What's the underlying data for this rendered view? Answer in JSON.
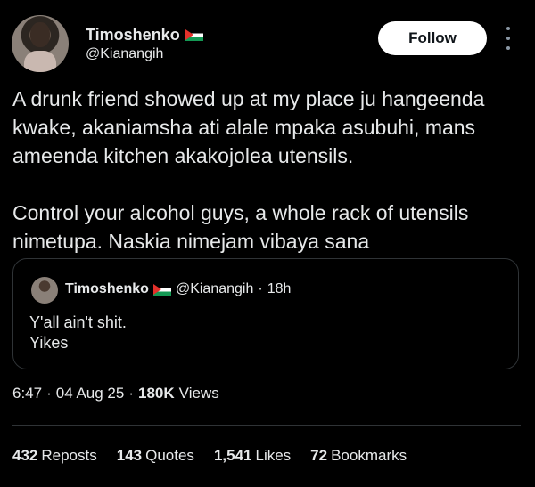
{
  "author": {
    "display_name": "Timoshenko",
    "handle": "@Kianangih",
    "flag_icon": "palestine-flag-icon"
  },
  "follow_label": "Follow",
  "tweet": {
    "text": "A drunk friend showed up at my place ju hangeenda kwake, akaniamsha ati alale mpaka asubuhi, mans ameenda kitchen akakojolea utensils.\n\nControl your alcohol guys, a whole rack of utensils nimetupa. Naskia nimejam vibaya sana"
  },
  "quoted": {
    "display_name": "Timoshenko",
    "handle": "@Kianangih",
    "separator": "·",
    "time": "18h",
    "line1": "Y'all ain't shit.",
    "line2": "Yikes"
  },
  "meta": {
    "time": "6:47",
    "separator": "·",
    "date": "04 Aug 25",
    "views_count": "180K",
    "views_label": "Views"
  },
  "stats": {
    "reposts_count": "432",
    "reposts_label": "Reposts",
    "quotes_count": "143",
    "quotes_label": "Quotes",
    "likes_count": "1,541",
    "likes_label": "Likes",
    "bookmarks_count": "72",
    "bookmarks_label": "Bookmarks"
  },
  "colors": {
    "background": "#000000",
    "text": "#e7e9ea",
    "border": "#2f3336",
    "button_bg": "#ffffff"
  }
}
